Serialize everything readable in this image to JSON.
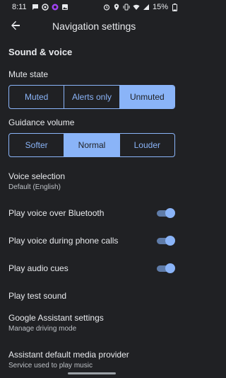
{
  "status_bar": {
    "time": "8:11",
    "battery": "15%",
    "left_icons": [
      "message-icon",
      "circle-dot-icon",
      "circle-app-icon",
      "image-icon"
    ],
    "right_icons": [
      "alarm-icon",
      "location-icon",
      "vibrate-icon",
      "wifi-icon",
      "signal-icon",
      "battery-icon"
    ]
  },
  "header": {
    "title": "Navigation settings",
    "back_icon": "arrow-back-icon"
  },
  "section": {
    "title": "Sound & voice"
  },
  "mute_state": {
    "label": "Mute state",
    "options": [
      "Muted",
      "Alerts only",
      "Unmuted"
    ],
    "selected": "Unmuted"
  },
  "guidance_volume": {
    "label": "Guidance volume",
    "options": [
      "Softer",
      "Normal",
      "Louder"
    ],
    "selected": "Normal"
  },
  "voice_selection": {
    "title": "Voice selection",
    "subtitle": "Default (English)"
  },
  "toggles": [
    {
      "label": "Play voice over Bluetooth",
      "on": true
    },
    {
      "label": "Play voice during phone calls",
      "on": true
    },
    {
      "label": "Play audio cues",
      "on": true
    }
  ],
  "test_sound": {
    "label": "Play test sound"
  },
  "assistant_settings": {
    "title": "Google Assistant settings",
    "subtitle": "Manage driving mode"
  },
  "media_provider": {
    "title": "Assistant default media provider",
    "subtitle": "Service used to play music"
  },
  "colors": {
    "background": "#202124",
    "accent": "#8ab4f8",
    "text_primary": "#e8eaed",
    "text_secondary": "#bdc1c6"
  }
}
